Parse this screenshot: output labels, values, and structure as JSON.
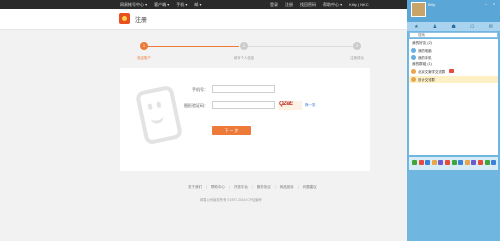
{
  "topbar": {
    "left_items": [
      "网易帐号中心 ▾",
      "客户端 ▾",
      "手机 ▾",
      "邮 ▾"
    ],
    "right_items": [
      "登录",
      "注册",
      "找回密码",
      "帮助中心 ▾",
      "Kitty | NKC"
    ]
  },
  "header": {
    "title": "注册"
  },
  "steps": [
    {
      "number": "1",
      "label": "验证账户",
      "active": true
    },
    {
      "number": "2",
      "label": "填写个人信息",
      "active": false
    },
    {
      "number": "3",
      "label": "注册成功",
      "active": false
    }
  ],
  "form": {
    "phone_label": "手机号：",
    "phone_value": "",
    "captcha_label": "图形验证码：",
    "captcha_value": "",
    "captcha_text": "QZeE",
    "refresh_label": "换一张",
    "next_label": "下 一 步"
  },
  "footer": {
    "links": [
      "关于我们",
      "帮助中心",
      "开放平台",
      "服务协议",
      "商品投诉",
      "问题建议"
    ],
    "copyright": "网易公司版权所有 ©1997-2016 ICP证编号"
  },
  "qq": {
    "name": "Kitty",
    "tabs": [
      "★",
      "♟",
      "☗",
      "☖",
      "✉"
    ],
    "search_placeholder": "搜索",
    "group_friends": "我的好友 (2)",
    "friends": [
      {
        "name": "我的电脑",
        "color": "#66b0e0"
      },
      {
        "name": "我的手机",
        "color": "#66b0e0"
      }
    ],
    "group_title": "我的群组 (1)",
    "items": [
      {
        "name": "北京文案学交流群",
        "color": "#e9a64b",
        "badge": true
      },
      {
        "name": "设计交流群",
        "color": "#e9a64b",
        "badge": false
      }
    ],
    "app_colors": [
      "#3fa63c",
      "#e64b3b",
      "#3b82d6",
      "#e9a64b",
      "#6a5acd",
      "#e64b3b",
      "#3fa63c",
      "#3b82d6",
      "#e9a64b",
      "#6a5acd",
      "#e64b3b",
      "#3fa63c",
      "#3b82d6"
    ]
  },
  "colors": {
    "accent": "#ee7a3a",
    "topbar": "#2a2a2a",
    "qq_blue": "#6fb6e0"
  }
}
